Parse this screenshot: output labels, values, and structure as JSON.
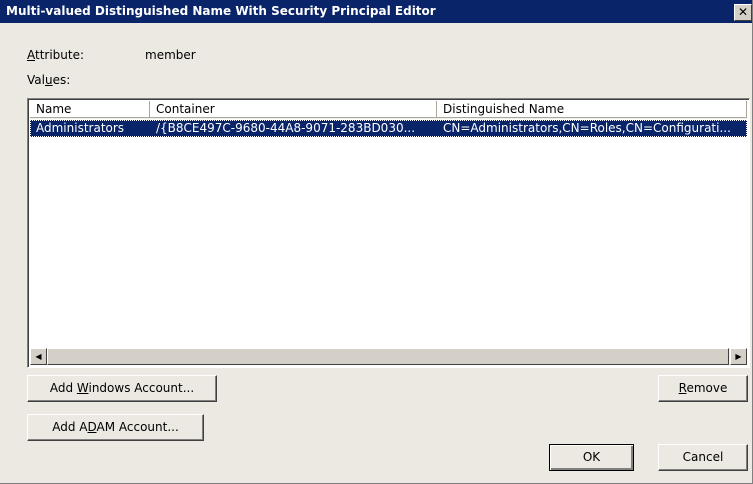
{
  "window": {
    "title": "Multi-valued Distinguished Name With Security Principal Editor",
    "close_glyph": "✕"
  },
  "attribute": {
    "label": "Attribute:",
    "value": "member"
  },
  "values_label": "Values:",
  "list": {
    "columns": [
      "Name",
      "Container",
      "Distinguished Name"
    ],
    "rows": [
      {
        "name": "Administrators",
        "container": "/{B8CE497C-9680-44A8-9071-283BD030...",
        "dn": "CN=Administrators,CN=Roles,CN=Configurati...",
        "selected": true
      }
    ]
  },
  "scroll": {
    "left_glyph": "◀",
    "right_glyph": "▶"
  },
  "buttons": {
    "add_windows": "Add Windows Account...",
    "add_adam": "Add ADAM Account...",
    "remove": "Remove",
    "ok": "OK",
    "cancel": "Cancel"
  },
  "colors": {
    "titlebar": "#0a246a",
    "selection": "#0a246a",
    "dialog": "#ebe9e2"
  }
}
